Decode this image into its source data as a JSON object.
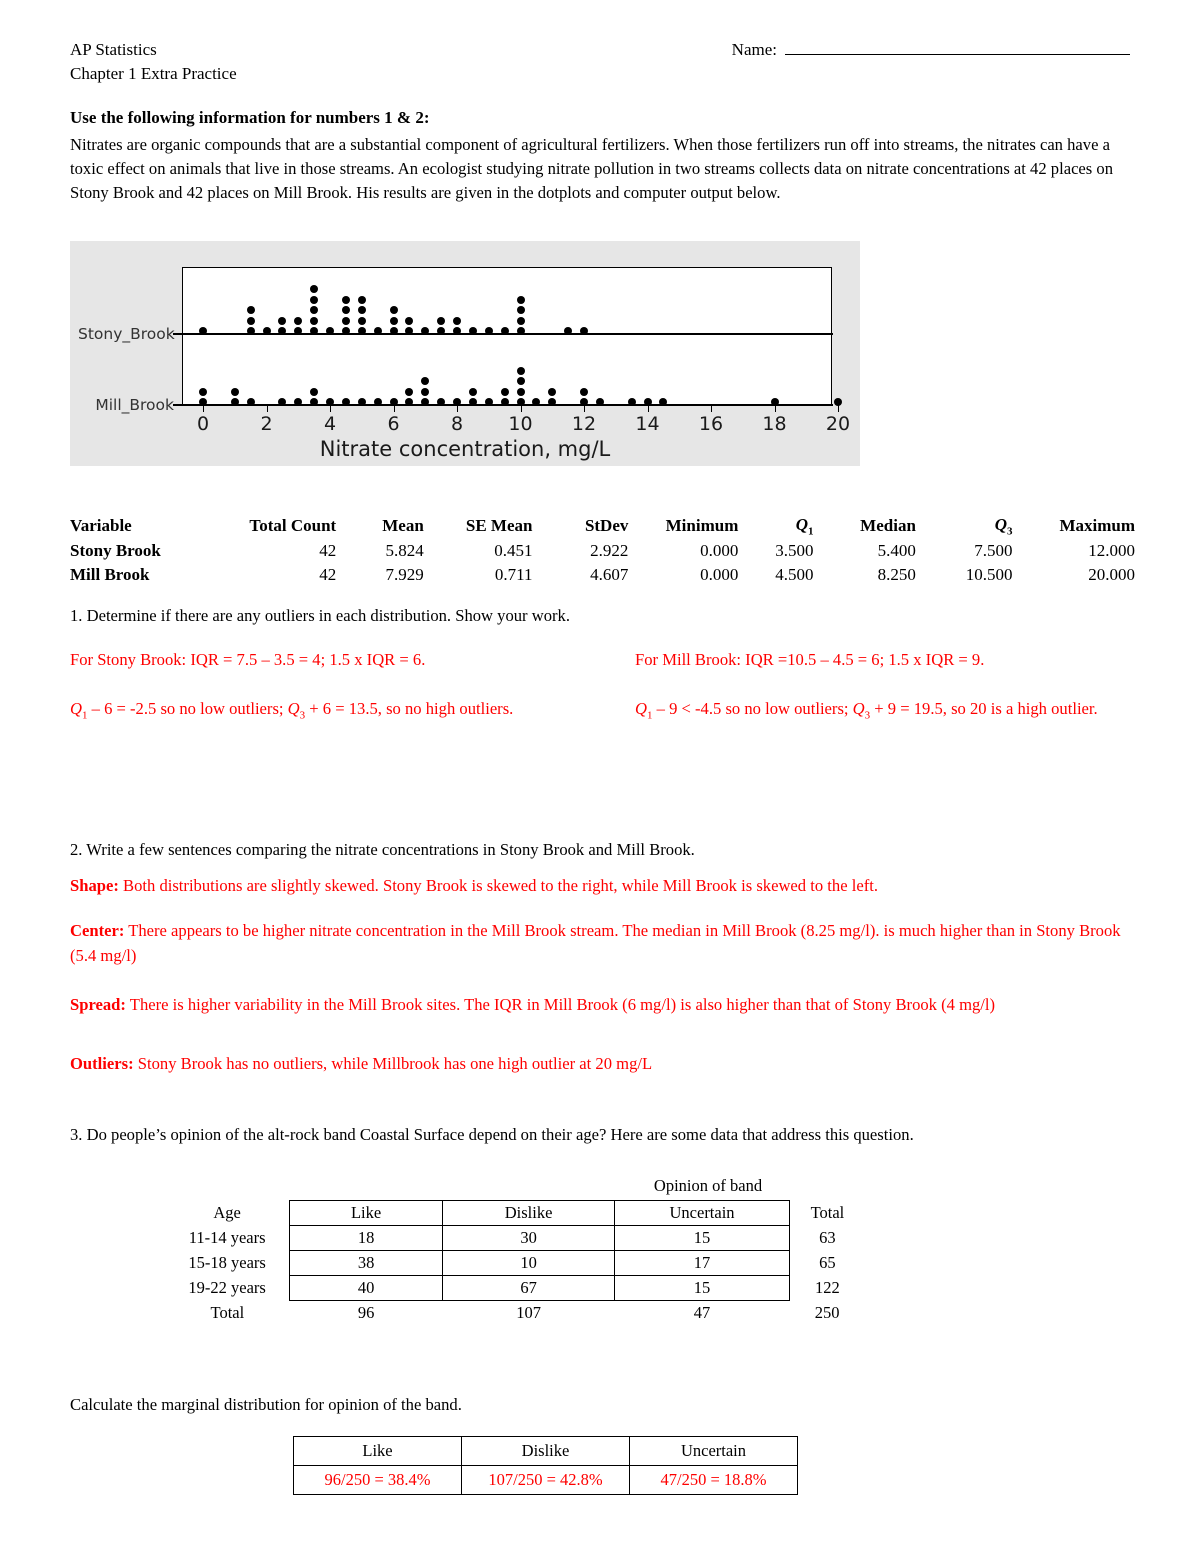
{
  "header": {
    "course": "AP Statistics",
    "subtitle": "Chapter 1 Extra Practice",
    "name_label": "Name:"
  },
  "prompt": {
    "title": "Use the following information for numbers 1 & 2:",
    "body": "Nitrates are organic compounds that are a substantial component of agricultural fertilizers.  When those fertilizers run off into streams, the nitrates can have a toxic effect on animals that live in those streams. An ecologist studying nitrate pollution in two streams collects data on nitrate concentrations at 42 places on Stony Brook and 42 places on Mill Brook. His results are given in the dotplots and computer output below."
  },
  "chart_data": {
    "type": "dotplot",
    "title": "",
    "xlabel": "Nitrate concentration, mg/L",
    "ylabel": "",
    "xlim": [
      -0.6,
      21.0
    ],
    "xticks": [
      0,
      2,
      4,
      6,
      8,
      10,
      12,
      14,
      16,
      18,
      20
    ],
    "grid": false,
    "legend": "none",
    "series": [
      {
        "name": "Stony_Brook",
        "n": 42,
        "stacks": [
          {
            "x": 0.0,
            "count": 1
          },
          {
            "x": 1.5,
            "count": 3
          },
          {
            "x": 2.0,
            "count": 1
          },
          {
            "x": 2.5,
            "count": 2
          },
          {
            "x": 3.0,
            "count": 2
          },
          {
            "x": 3.5,
            "count": 5
          },
          {
            "x": 4.0,
            "count": 1
          },
          {
            "x": 4.5,
            "count": 4
          },
          {
            "x": 5.0,
            "count": 4
          },
          {
            "x": 5.5,
            "count": 1
          },
          {
            "x": 6.0,
            "count": 3
          },
          {
            "x": 6.5,
            "count": 2
          },
          {
            "x": 7.0,
            "count": 1
          },
          {
            "x": 7.5,
            "count": 2
          },
          {
            "x": 8.0,
            "count": 2
          },
          {
            "x": 8.5,
            "count": 1
          },
          {
            "x": 9.0,
            "count": 1
          },
          {
            "x": 9.5,
            "count": 1
          },
          {
            "x": 10.0,
            "count": 4
          },
          {
            "x": 11.5,
            "count": 1
          },
          {
            "x": 12.0,
            "count": 1
          }
        ]
      },
      {
        "name": "Mill_Brook",
        "n": 42,
        "stacks": [
          {
            "x": 0.0,
            "count": 2
          },
          {
            "x": 1.0,
            "count": 2
          },
          {
            "x": 1.5,
            "count": 1
          },
          {
            "x": 2.5,
            "count": 1
          },
          {
            "x": 3.0,
            "count": 1
          },
          {
            "x": 3.5,
            "count": 2
          },
          {
            "x": 4.0,
            "count": 1
          },
          {
            "x": 4.5,
            "count": 1
          },
          {
            "x": 5.0,
            "count": 1
          },
          {
            "x": 5.5,
            "count": 1
          },
          {
            "x": 6.0,
            "count": 1
          },
          {
            "x": 6.5,
            "count": 2
          },
          {
            "x": 7.0,
            "count": 3
          },
          {
            "x": 7.5,
            "count": 1
          },
          {
            "x": 8.0,
            "count": 1
          },
          {
            "x": 8.5,
            "count": 2
          },
          {
            "x": 9.0,
            "count": 1
          },
          {
            "x": 9.5,
            "count": 2
          },
          {
            "x": 10.0,
            "count": 4
          },
          {
            "x": 10.5,
            "count": 1
          },
          {
            "x": 11.0,
            "count": 2
          },
          {
            "x": 12.0,
            "count": 2
          },
          {
            "x": 12.5,
            "count": 1
          },
          {
            "x": 13.5,
            "count": 1
          },
          {
            "x": 14.0,
            "count": 1
          },
          {
            "x": 14.5,
            "count": 1
          },
          {
            "x": 18.0,
            "count": 1
          },
          {
            "x": 20.0,
            "count": 1
          }
        ]
      }
    ]
  },
  "stats_table": {
    "columns": [
      "Variable",
      "Total Count",
      "Mean",
      "SE Mean",
      "StDev",
      "Minimum",
      "Q1",
      "Median",
      "Q3",
      "Maximum"
    ],
    "rows": [
      {
        "variable": "Stony Brook",
        "total_count": "42",
        "mean": "5.824",
        "se_mean": "0.451",
        "stdev": "2.922",
        "minimum": "0.000",
        "q1": "3.500",
        "median": "5.400",
        "q3": "7.500",
        "maximum": "12.000"
      },
      {
        "variable": "Mill Brook",
        "total_count": "42",
        "mean": "7.929",
        "se_mean": "0.711",
        "stdev": "4.607",
        "minimum": "0.000",
        "q1": "4.500",
        "median": "8.250",
        "q3": "10.500",
        "maximum": "20.000"
      }
    ]
  },
  "question1": {
    "text": "1. Determine if there are any outliers in each distribution. Show your work.",
    "answer_left_line1": "For Stony Brook:  IQR = 7.5 – 3.5 = 4;   1.5 x IQR = 6.",
    "answer_left_line2_pre": "Q",
    "answer_left_line2_sub1": "1",
    "answer_left_line2_mid": " – 6 = -2.5 so no low outliers; ",
    "answer_left_line2_pre2": "Q",
    "answer_left_line2_sub2": "3",
    "answer_left_line2_end": " + 6 = 13.5, so no high outliers.",
    "answer_right_line1": "For Mill Brook: IQR =10.5 – 4.5 = 6;  1.5 x IQR = 9.",
    "answer_right_line2_mid": " – 9 < -4.5 so no low outliers; ",
    "answer_right_line2_end": " + 9 = 19.5, so 20 is a high outlier."
  },
  "question2": {
    "text": "2. Write a few sentences comparing the nitrate concentrations in Stony Brook and Mill Brook.",
    "shape_label": "Shape:",
    "shape_text": " Both distributions are slightly skewed.  Stony Brook is skewed to the right, while Mill Brook is skewed to the left.",
    "center_label": "Center:",
    "center_text": " There appears to be higher nitrate concentration in the Mill Brook stream.  The median in Mill Brook (8.25 mg/l). is much higher than in Stony Brook (5.4 mg/l)",
    "spread_label": "Spread:",
    "spread_text": "  There is higher variability in the Mill Brook sites.  The IQR in Mill Brook (6 mg/l) is also higher than that of Stony Brook (4 mg/l)",
    "outliers_label": "Outliers:",
    "outliers_text": " Stony Brook has no outliers, while Millbrook has one high outlier at 20 mg/L"
  },
  "question3": {
    "text": "3. Do people’s opinion of the alt-rock band Coastal Surface depend on their age?  Here are some data that address this question.",
    "table_caption": "Opinion of band",
    "corner_label": "Age",
    "columns": [
      "Like",
      "Dislike",
      "Uncertain"
    ],
    "total_label": "Total",
    "rows": [
      {
        "age": "11-14 years",
        "like": "18",
        "dislike": "30",
        "uncertain": "15",
        "total": "63"
      },
      {
        "age": "15-18 years",
        "like": "38",
        "dislike": "10",
        "uncertain": "17",
        "total": "65"
      },
      {
        "age": "19-22 years",
        "like": "40",
        "dislike": "67",
        "uncertain": "15",
        "total": "122"
      }
    ],
    "totals": {
      "age": "Total",
      "like": "96",
      "dislike": "107",
      "uncertain": "47",
      "total": "250"
    }
  },
  "marginal": {
    "prompt": "Calculate the marginal distribution for opinion of the band.",
    "columns": [
      "Like",
      "Dislike",
      "Uncertain"
    ],
    "values": [
      "96/250 = 38.4%",
      "107/250 = 42.8%",
      "47/250 = 18.8%"
    ]
  }
}
